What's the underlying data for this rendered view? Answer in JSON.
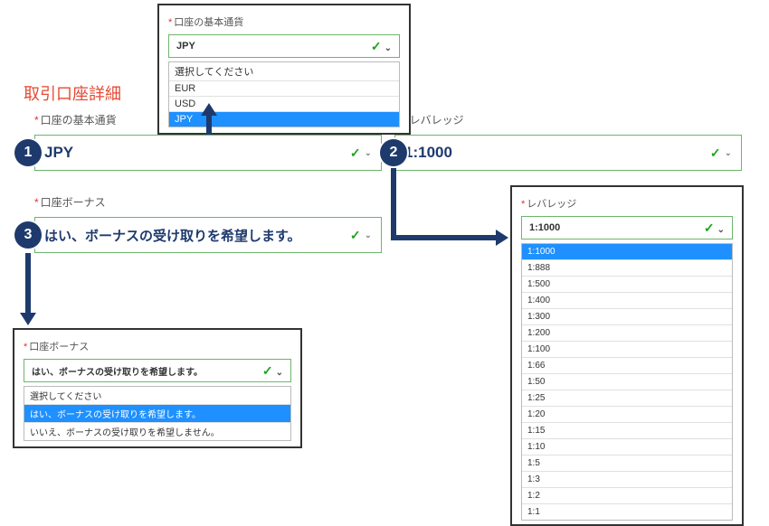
{
  "title": "取引口座詳細",
  "badges": [
    "1",
    "2",
    "3"
  ],
  "labels": {
    "currency": "口座の基本通貨",
    "leverage": "レバレッジ",
    "bonus": "口座ボーナス"
  },
  "main": {
    "currency_value": "JPY",
    "leverage_value": "1:1000",
    "bonus_value": "はい、ボーナスの受け取りを希望します。"
  },
  "currency_panel": {
    "selected": "JPY",
    "options": [
      "選択してください",
      "EUR",
      "USD",
      "JPY"
    ],
    "selected_index": 3
  },
  "bonus_panel": {
    "selected": "はい、ボーナスの受け取りを希望します。",
    "options": [
      "選択してください",
      "はい、ボーナスの受け取りを希望します。",
      "いいえ、ボーナスの受け取りを希望しません。"
    ],
    "selected_index": 1
  },
  "leverage_panel": {
    "selected": "1:1000",
    "options": [
      "1:1000",
      "1:888",
      "1:500",
      "1:400",
      "1:300",
      "1:200",
      "1:100",
      "1:66",
      "1:50",
      "1:25",
      "1:20",
      "1:15",
      "1:10",
      "1:5",
      "1:3",
      "1:2",
      "1:1"
    ],
    "selected_index": 0
  }
}
